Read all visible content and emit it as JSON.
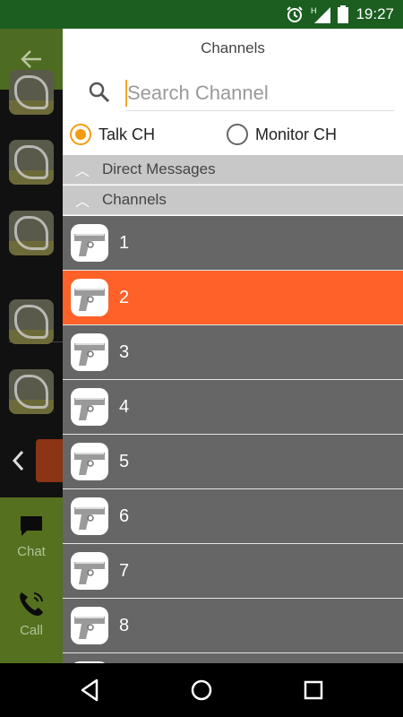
{
  "status_bar": {
    "time": "19:27",
    "icons": [
      "alarm-icon",
      "signal-h-icon",
      "battery-icon"
    ]
  },
  "background_app": {
    "nav": {
      "chat_label": "Chat",
      "call_label": "Call"
    }
  },
  "drawer": {
    "title": "Channels",
    "search": {
      "placeholder": "Search Channel",
      "value": ""
    },
    "radios": [
      {
        "label": "Talk CH",
        "checked": true
      },
      {
        "label": "Monitor CH",
        "checked": false
      }
    ],
    "sections": [
      {
        "label": "Direct Messages"
      },
      {
        "label": "Channels"
      }
    ],
    "channels": [
      {
        "name": "1",
        "selected": false
      },
      {
        "name": "2",
        "selected": true
      },
      {
        "name": "3",
        "selected": false
      },
      {
        "name": "4",
        "selected": false
      },
      {
        "name": "5",
        "selected": false
      },
      {
        "name": "6",
        "selected": false
      },
      {
        "name": "7",
        "selected": false
      },
      {
        "name": "8",
        "selected": false
      },
      {
        "name": "",
        "selected": false
      }
    ]
  },
  "colors": {
    "accent": "#ff6128",
    "radio": "#f39c12",
    "row": "#666666",
    "status_bar": "#1b5e20"
  }
}
